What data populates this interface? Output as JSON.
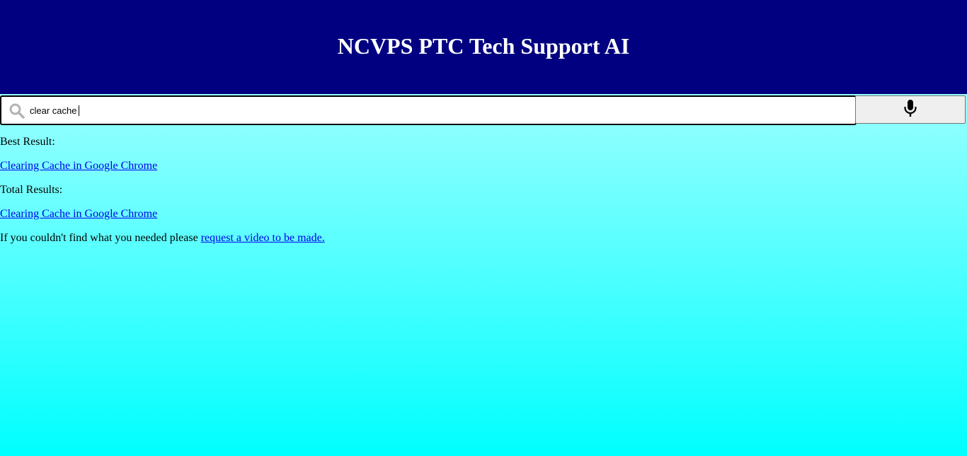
{
  "header": {
    "title": "NCVPS PTC Tech Support AI",
    "background": "#000080"
  },
  "search": {
    "value": "clear cache",
    "icon": "search-icon"
  },
  "mic": {
    "icon": "microphone-icon"
  },
  "results": {
    "best_label": "Best Result:",
    "best_link": "Clearing Cache in Google Chrome",
    "total_label": "Total Results:",
    "total_links": [
      "Clearing Cache in Google Chrome"
    ],
    "footer_text": "If you couldn't find what you needed please ",
    "footer_link": "request a video to be made."
  },
  "colors": {
    "gradient_top": "#c2ffff",
    "gradient_bottom": "#00ffff",
    "link": "#0000ee"
  }
}
